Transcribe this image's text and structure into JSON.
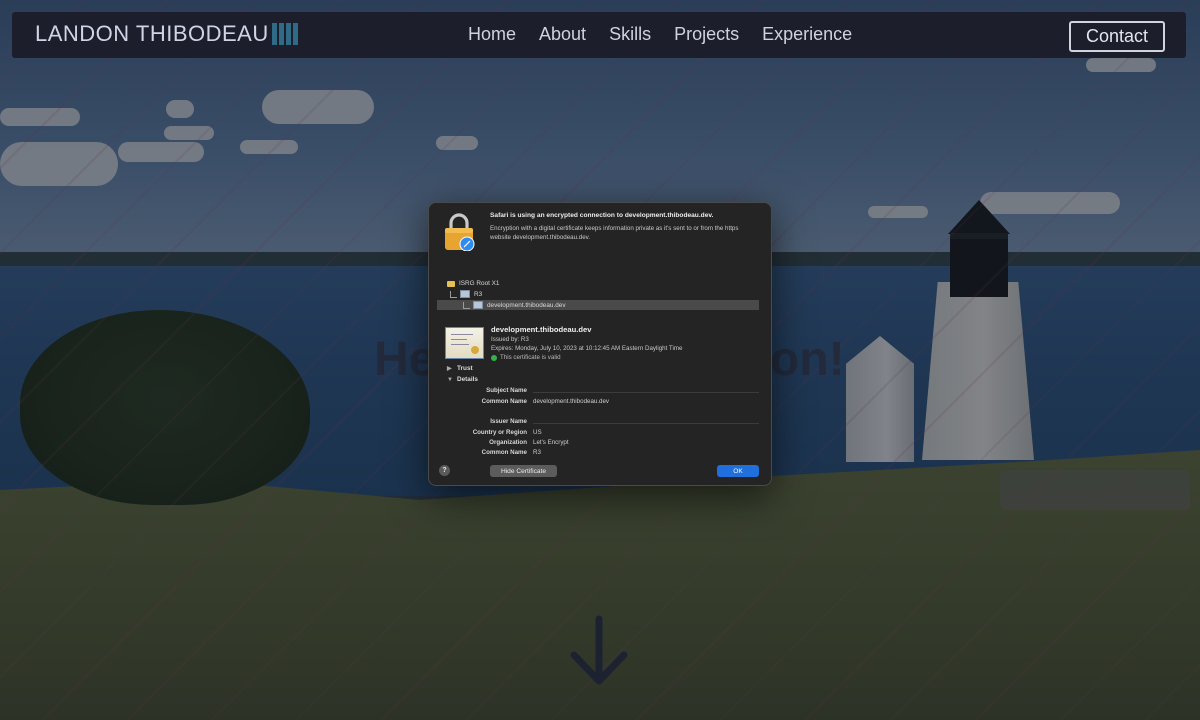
{
  "navbar": {
    "brand": "LANDON THIBODEAU",
    "links": [
      "Home",
      "About",
      "Skills",
      "Projects",
      "Experience"
    ],
    "contact_label": "Contact"
  },
  "hero": {
    "heading_left_fragment": "He",
    "heading_right_fragment": "on!",
    "scroll_icon": "arrow-down-icon"
  },
  "dialog": {
    "title": "Safari is using an encrypted connection to development.thibodeau.dev.",
    "description": "Encryption with a digital certificate keeps information private as it's sent to or from the https website development.thibodeau.dev.",
    "chain": [
      "ISRG Root X1",
      "R3",
      "development.thibodeau.dev"
    ],
    "certificate": {
      "common_name": "development.thibodeau.dev",
      "issued_by": "Issued by: R3",
      "expires": "Expires: Monday, July 10, 2023 at 10:12:45 AM Eastern Daylight Time",
      "status": "This certificate is valid"
    },
    "trust_label": "Trust",
    "details_label": "Details",
    "subject_section": "Subject Name",
    "subject_common_name_key": "Common Name",
    "subject_common_name": "development.thibodeau.dev",
    "issuer_section": "Issuer Name",
    "issuer_fields": [
      {
        "key": "Country or Region",
        "value": "US"
      },
      {
        "key": "Organization",
        "value": "Let's Encrypt"
      },
      {
        "key": "Common Name",
        "value": "R3"
      }
    ],
    "help_label": "?",
    "hide_label": "Hide Certificate",
    "ok_label": "OK"
  },
  "colors": {
    "navbar_bg": "#1c1f2b",
    "brand_accent": "#2f6b87",
    "dialog_bg": "#242424",
    "ok_button": "#1f6fdc",
    "valid_green": "#36b24a"
  }
}
